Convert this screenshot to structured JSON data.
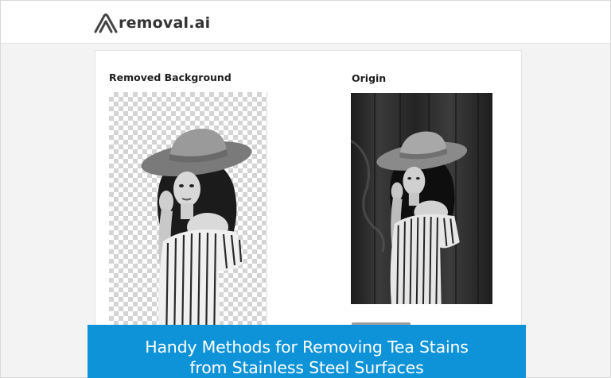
{
  "brand": {
    "name": "removal.ai",
    "logo_icon": "removal-ai-logo-icon"
  },
  "panels": {
    "removed": {
      "title": "Removed Background",
      "background": "transparency-checkerboard"
    },
    "origin": {
      "title": "Origin"
    }
  },
  "banner": {
    "line1": "Handy Methods for Removing Tea Stains",
    "line2": "from Stainless Steel Surfaces",
    "color": "#0f93d8"
  }
}
